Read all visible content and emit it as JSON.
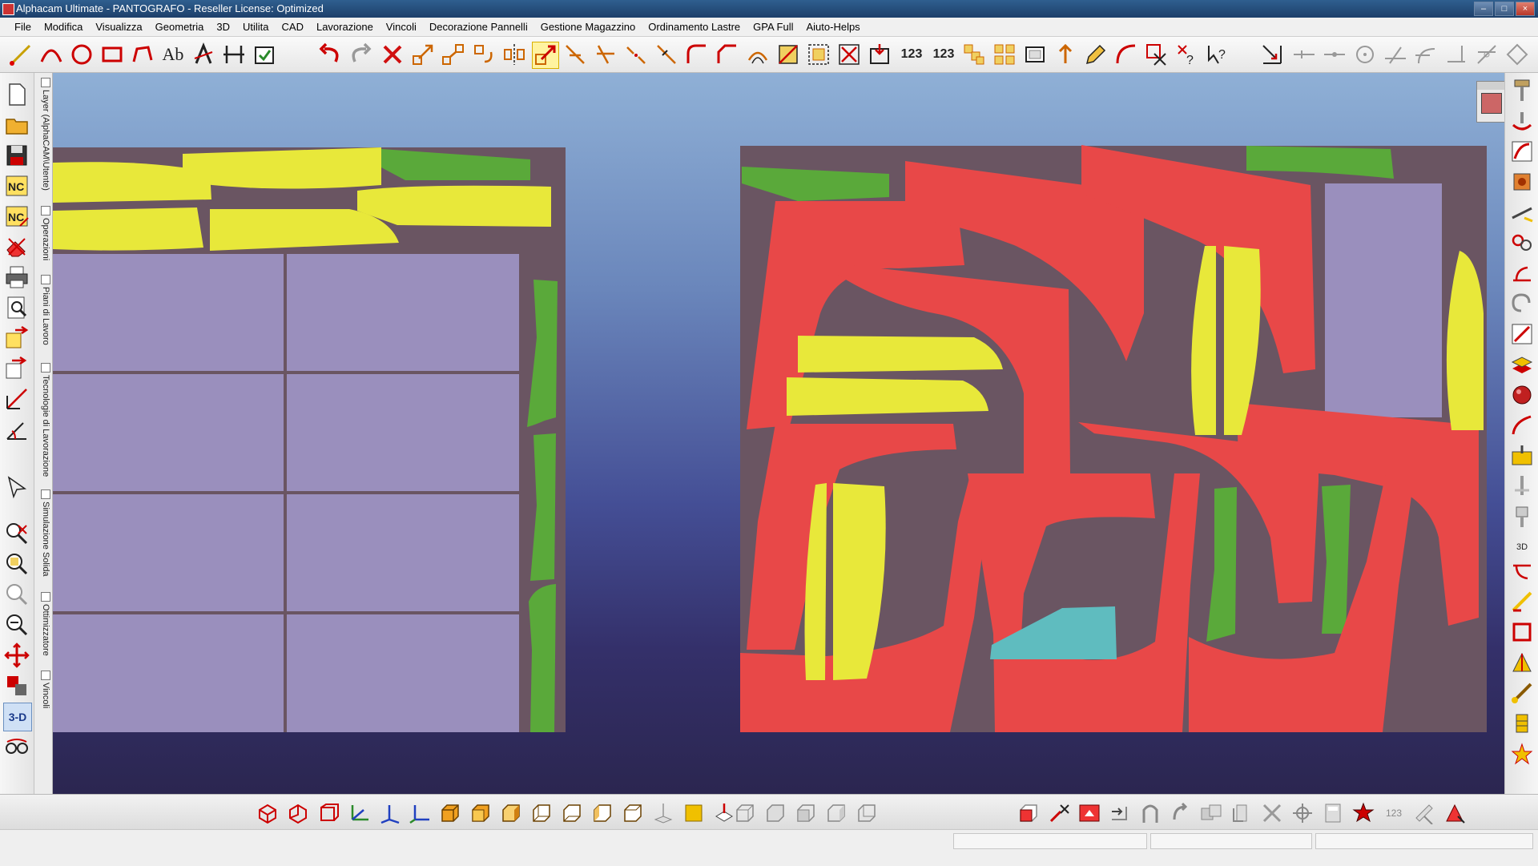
{
  "window": {
    "title": "Alphacam Ultimate - PANTOGRAFO - Reseller License: Optimized",
    "controls": [
      "minimize",
      "maximize",
      "close"
    ]
  },
  "menubar": {
    "items": [
      {
        "label": "File"
      },
      {
        "label": "Modifica"
      },
      {
        "label": "Visualizza"
      },
      {
        "label": "Geometria"
      },
      {
        "label": "3D"
      },
      {
        "label": "Utilita"
      },
      {
        "label": "CAD"
      },
      {
        "label": "Lavorazione"
      },
      {
        "label": "Vincoli"
      },
      {
        "label": "Decorazione Pannelli"
      },
      {
        "label": "Gestione Magazzino"
      },
      {
        "label": "Ordinamento Lastre"
      },
      {
        "label": "GPA Full"
      },
      {
        "label": "Aiuto-Helps"
      }
    ]
  },
  "side_tabs": {
    "items": [
      {
        "label": "Layer (AlphaCAM\\Utente)"
      },
      {
        "label": "Operazioni"
      },
      {
        "label": "Piani di Lavoro"
      },
      {
        "label": "Tecnologie di Lavorazione"
      },
      {
        "label": "Simulazione Solida"
      },
      {
        "label": "Ottimizzatore"
      },
      {
        "label": "Vincoli"
      }
    ]
  },
  "toolbar": {
    "text_icon_label": "Ab",
    "number_label_1": "123",
    "number_label_2": "123"
  },
  "left_toolbar": {
    "view_3d_label": "3-D"
  },
  "right_toolbar": {
    "label_3d": "3D"
  },
  "bottom_toolbar": {
    "number_label": "123"
  },
  "colors": {
    "sheet_background": "#6a5562",
    "part_yellow": "#e8e83a",
    "part_green": "#5aa93a",
    "part_purple": "#9a8fbd",
    "part_red": "#e84848",
    "part_cyan": "#5fbcbf"
  }
}
